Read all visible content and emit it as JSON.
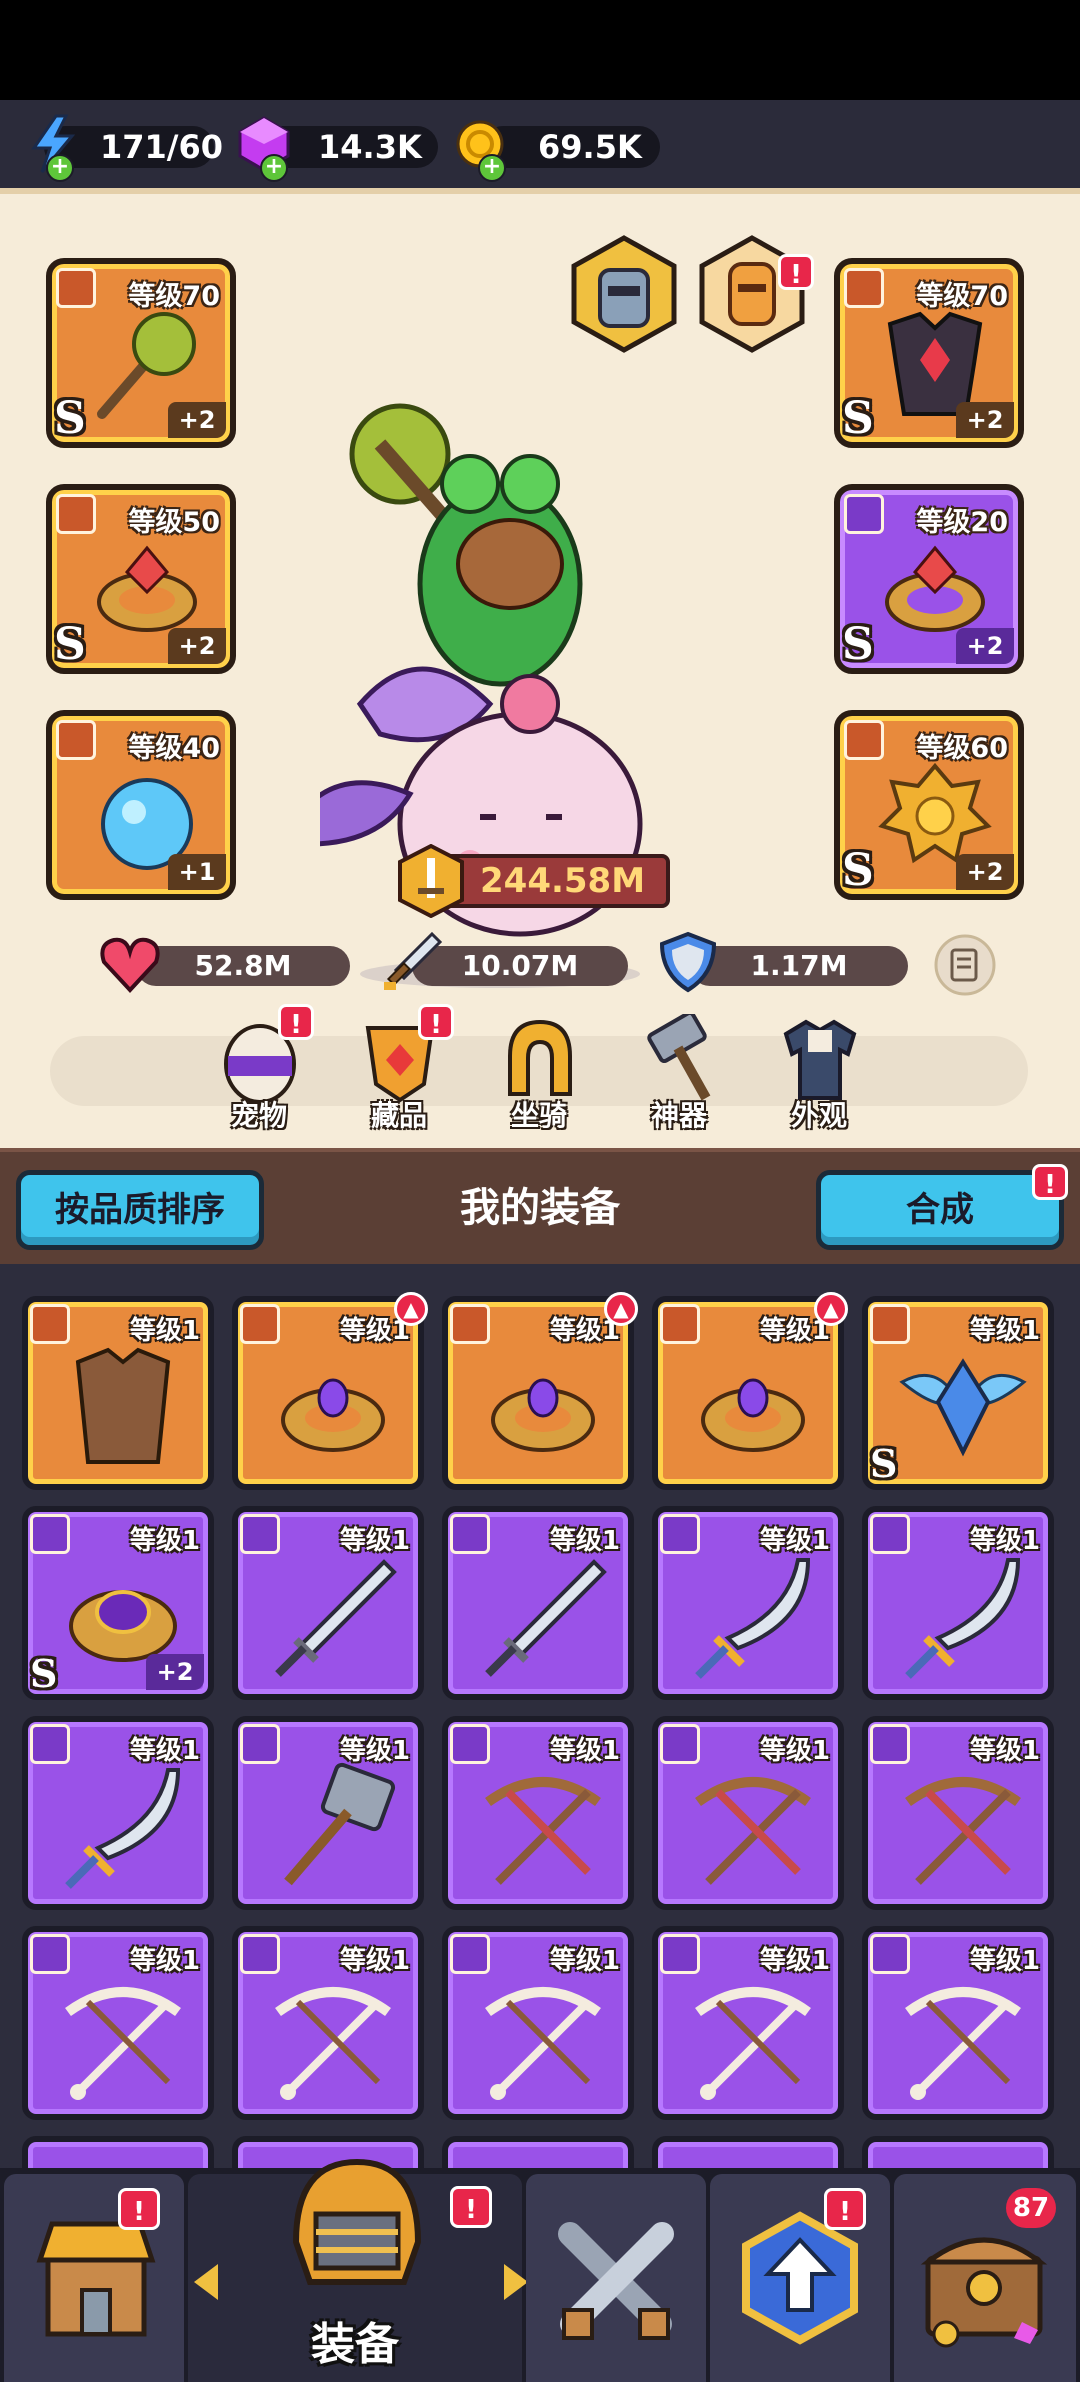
{
  "resources": {
    "energy": "171/60",
    "gems": "14.3K",
    "coins": "69.5K"
  },
  "hero": {
    "power": "244.58M",
    "stats": {
      "health": "52.8M",
      "attack": "10.07M",
      "defense": "1.17M"
    },
    "left_slots": [
      {
        "level": "等级70",
        "grade": "S",
        "plus": "+2",
        "icon": "sword-icon",
        "art": "spiked-mace-icon"
      },
      {
        "level": "等级50",
        "grade": "S",
        "plus": "+2",
        "icon": "ring-icon",
        "art": "ruby-ring-icon"
      },
      {
        "level": "等级40",
        "grade": "",
        "plus": "+1",
        "icon": "necklace-icon",
        "art": "crystal-orb-icon"
      }
    ],
    "right_slots": [
      {
        "level": "等级70",
        "grade": "S",
        "plus": "+2",
        "icon": "armor-icon",
        "art": "dark-armor-icon"
      },
      {
        "level": "等级20",
        "grade": "S",
        "plus": "+2",
        "icon": "ring-icon",
        "art": "ruby-ring-icon"
      },
      {
        "level": "等级60",
        "grade": "S",
        "plus": "+2",
        "icon": "necklace-icon",
        "art": "golden-medallion-icon"
      }
    ],
    "functions": [
      {
        "label": "宠物",
        "icon": "pet-egg-icon",
        "badge": "!"
      },
      {
        "label": "藏品",
        "icon": "collection-icon",
        "badge": "!"
      },
      {
        "label": "坐骑",
        "icon": "mount-horseshoe-icon",
        "badge": ""
      },
      {
        "label": "神器",
        "icon": "artifact-hammer-icon",
        "badge": ""
      },
      {
        "label": "外观",
        "icon": "costume-icon",
        "badge": ""
      }
    ],
    "top_badge": "!"
  },
  "section": {
    "sort_label": "按品质排序",
    "title": "我的装备",
    "merge_label": "合成",
    "merge_badge": "!"
  },
  "inventory": [
    {
      "level": "等级1",
      "rarity": "orange",
      "type": "armor-icon",
      "art": "leather-vest-icon",
      "grade": "",
      "plus": "",
      "up": false
    },
    {
      "level": "等级1",
      "rarity": "orange",
      "type": "ring-icon",
      "art": "gold-ring-icon",
      "grade": "",
      "plus": "",
      "up": true
    },
    {
      "level": "等级1",
      "rarity": "orange",
      "type": "ring-icon",
      "art": "gold-ring-icon",
      "grade": "",
      "plus": "",
      "up": true
    },
    {
      "level": "等级1",
      "rarity": "orange",
      "type": "ring-icon",
      "art": "gold-ring-icon",
      "grade": "",
      "plus": "",
      "up": true
    },
    {
      "level": "等级1",
      "rarity": "orange",
      "type": "necklace-icon",
      "art": "winged-amulet-icon",
      "grade": "S",
      "plus": "",
      "up": false
    },
    {
      "level": "等级1",
      "rarity": "purple",
      "type": "ring-icon",
      "art": "ornate-ring-icon",
      "grade": "S",
      "plus": "+2",
      "up": false
    },
    {
      "level": "等级1",
      "rarity": "purple",
      "type": "sword-icon",
      "art": "broadsword-icon",
      "grade": "",
      "plus": "",
      "up": false
    },
    {
      "level": "等级1",
      "rarity": "purple",
      "type": "sword-icon",
      "art": "broadsword-icon",
      "grade": "",
      "plus": "",
      "up": false
    },
    {
      "level": "等级1",
      "rarity": "purple",
      "type": "sword-icon",
      "art": "scimitar-icon",
      "grade": "",
      "plus": "",
      "up": false
    },
    {
      "level": "等级1",
      "rarity": "purple",
      "type": "sword-icon",
      "art": "scimitar-icon",
      "grade": "",
      "plus": "",
      "up": false
    },
    {
      "level": "等级1",
      "rarity": "purple",
      "type": "sword-icon",
      "art": "scimitar-icon",
      "grade": "",
      "plus": "",
      "up": false
    },
    {
      "level": "等级1",
      "rarity": "purple",
      "type": "sword-icon",
      "art": "war-hammer-icon",
      "grade": "",
      "plus": "",
      "up": false
    },
    {
      "level": "等级1",
      "rarity": "purple",
      "type": "sword-icon",
      "art": "crossbow-icon",
      "grade": "",
      "plus": "",
      "up": false
    },
    {
      "level": "等级1",
      "rarity": "purple",
      "type": "sword-icon",
      "art": "crossbow-icon",
      "grade": "",
      "plus": "",
      "up": false
    },
    {
      "level": "等级1",
      "rarity": "purple",
      "type": "sword-icon",
      "art": "crossbow-icon",
      "grade": "",
      "plus": "",
      "up": false
    },
    {
      "level": "等级1",
      "rarity": "purple",
      "type": "sword-icon",
      "art": "bone-bow-icon",
      "grade": "",
      "plus": "",
      "up": false
    },
    {
      "level": "等级1",
      "rarity": "purple",
      "type": "sword-icon",
      "art": "bone-bow-icon",
      "grade": "",
      "plus": "",
      "up": false
    },
    {
      "level": "等级1",
      "rarity": "purple",
      "type": "sword-icon",
      "art": "bone-bow-icon",
      "grade": "",
      "plus": "",
      "up": false
    },
    {
      "level": "等级1",
      "rarity": "purple",
      "type": "sword-icon",
      "art": "bone-bow-icon",
      "grade": "",
      "plus": "",
      "up": false
    },
    {
      "level": "等级1",
      "rarity": "purple",
      "type": "sword-icon",
      "art": "bone-bow-icon",
      "grade": "",
      "plus": "",
      "up": false
    }
  ],
  "nav": {
    "equip_label": "装备",
    "shop_badge": "!",
    "equip_badge": "!",
    "upgrade_badge": "!",
    "chest_count": "87"
  },
  "colors": {
    "orange_rarity": "#e88a3c",
    "purple_rarity": "#9a52e8",
    "accent_cyan": "#3fc4ec",
    "badge_red": "#e8264a"
  }
}
